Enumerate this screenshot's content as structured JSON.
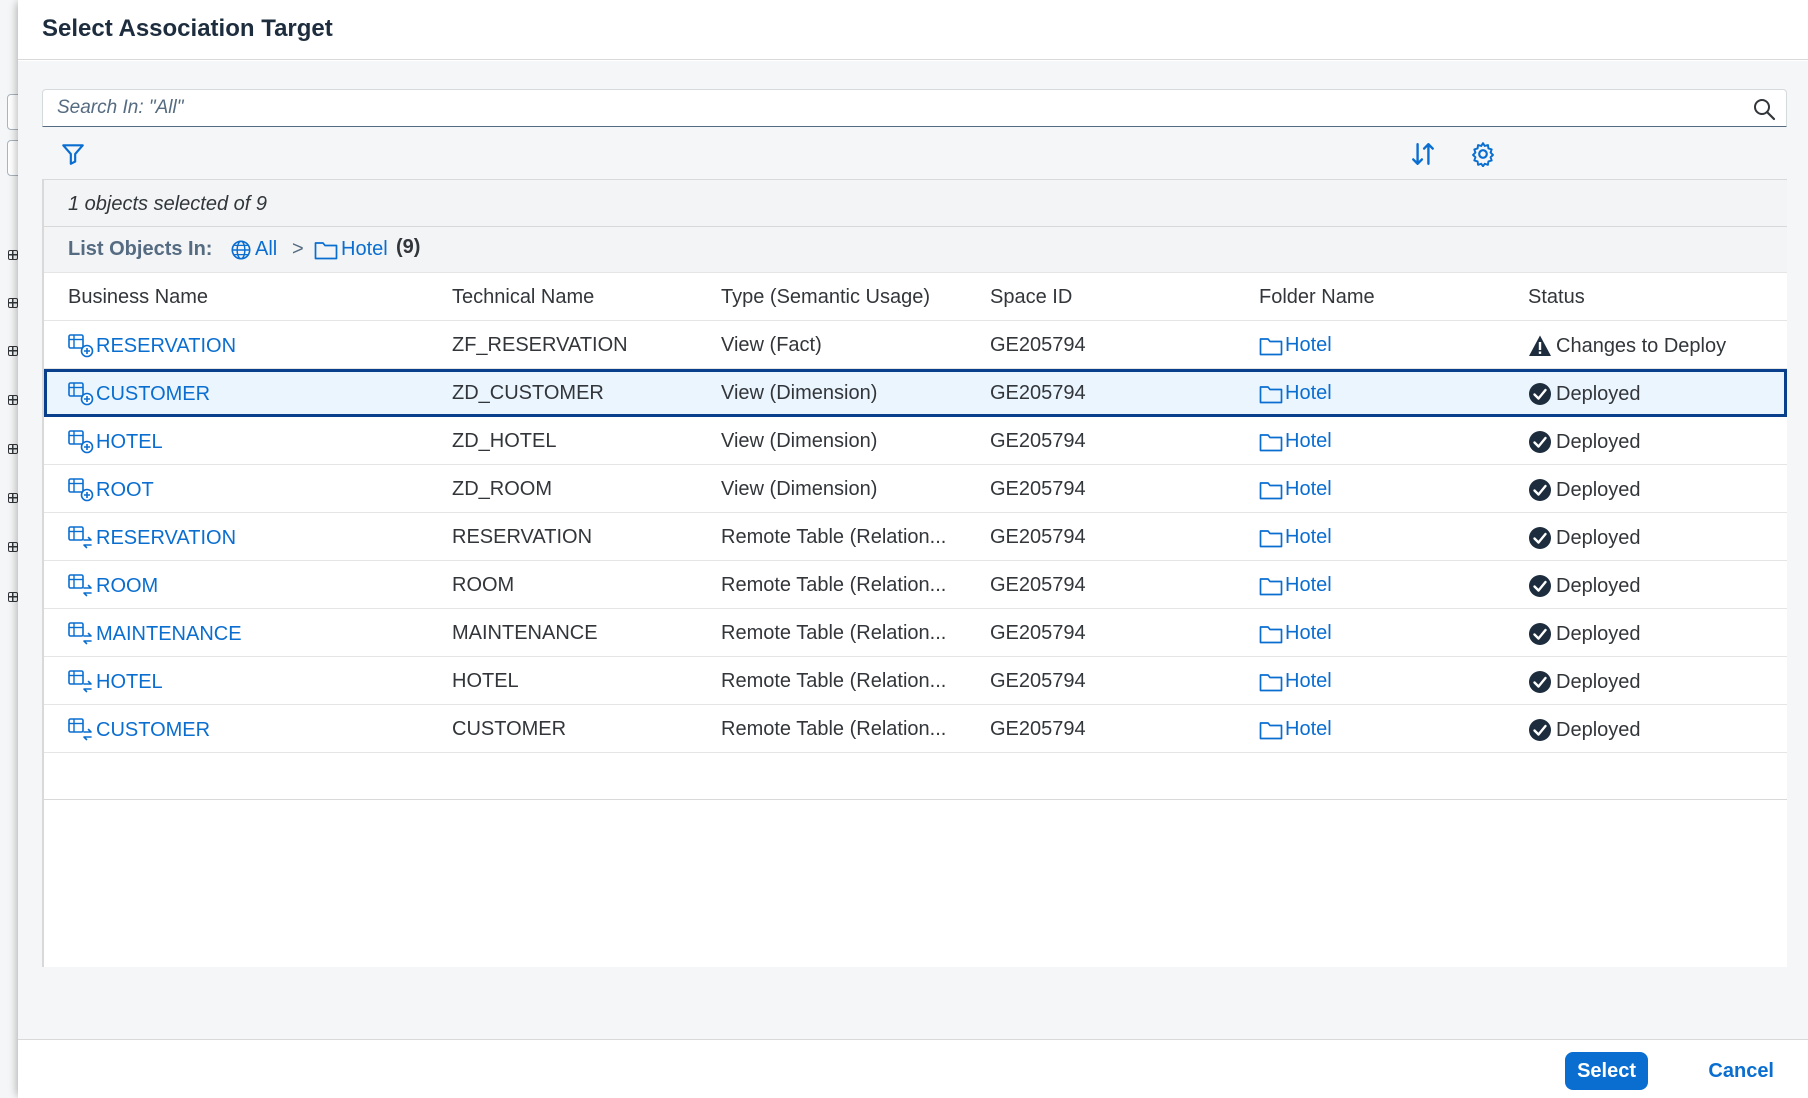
{
  "dialog": {
    "title": "Select Association Target"
  },
  "search": {
    "placeholder": "Search In: \"All\"",
    "icon": "search-icon"
  },
  "toolbar": {
    "filter_icon": "filter-icon",
    "sort_icon": "sort-icon",
    "settings_icon": "gear-icon"
  },
  "selection_info": "1 objects selected of 9",
  "breadcrumb": {
    "label": "List Objects In:",
    "root": "All",
    "separator": ">",
    "folder": "Hotel",
    "count": "(9)"
  },
  "table": {
    "columns": [
      "Business Name",
      "Technical Name",
      "Type (Semantic Usage)",
      "Space ID",
      "Folder Name",
      "Status"
    ],
    "rows": [
      {
        "business_name": "RESERVATION",
        "technical_name": "ZF_RESERVATION",
        "type": "View (Fact)",
        "space_id": "GE205794",
        "folder": "Hotel",
        "status": "Changes to Deploy",
        "icon": "view-icon",
        "status_icon": "warning-icon",
        "selected": false
      },
      {
        "business_name": "CUSTOMER",
        "technical_name": "ZD_CUSTOMER",
        "type": "View (Dimension)",
        "space_id": "GE205794",
        "folder": "Hotel",
        "status": "Deployed",
        "icon": "view-icon",
        "status_icon": "check-circle-icon",
        "selected": true
      },
      {
        "business_name": "HOTEL",
        "technical_name": "ZD_HOTEL",
        "type": "View (Dimension)",
        "space_id": "GE205794",
        "folder": "Hotel",
        "status": "Deployed",
        "icon": "view-icon",
        "status_icon": "check-circle-icon",
        "selected": false
      },
      {
        "business_name": "ROOT",
        "technical_name": "ZD_ROOM",
        "type": "View (Dimension)",
        "space_id": "GE205794",
        "folder": "Hotel",
        "status": "Deployed",
        "icon": "view-icon",
        "status_icon": "check-circle-icon",
        "selected": false
      },
      {
        "business_name": "RESERVATION",
        "technical_name": "RESERVATION",
        "type": "Remote Table (Relation...",
        "space_id": "GE205794",
        "folder": "Hotel",
        "status": "Deployed",
        "icon": "remote-table-icon",
        "status_icon": "check-circle-icon",
        "selected": false
      },
      {
        "business_name": "ROOM",
        "technical_name": "ROOM",
        "type": "Remote Table (Relation...",
        "space_id": "GE205794",
        "folder": "Hotel",
        "status": "Deployed",
        "icon": "remote-table-icon",
        "status_icon": "check-circle-icon",
        "selected": false
      },
      {
        "business_name": "MAINTENANCE",
        "technical_name": "MAINTENANCE",
        "type": "Remote Table (Relation...",
        "space_id": "GE205794",
        "folder": "Hotel",
        "status": "Deployed",
        "icon": "remote-table-icon",
        "status_icon": "check-circle-icon",
        "selected": false
      },
      {
        "business_name": "HOTEL",
        "technical_name": "HOTEL",
        "type": "Remote Table (Relation...",
        "space_id": "GE205794",
        "folder": "Hotel",
        "status": "Deployed",
        "icon": "remote-table-icon",
        "status_icon": "check-circle-icon",
        "selected": false
      },
      {
        "business_name": "CUSTOMER",
        "technical_name": "CUSTOMER",
        "type": "Remote Table (Relation...",
        "space_id": "GE205794",
        "folder": "Hotel",
        "status": "Deployed",
        "icon": "remote-table-icon",
        "status_icon": "check-circle-icon",
        "selected": false
      }
    ]
  },
  "footer": {
    "select_label": "Select",
    "cancel_label": "Cancel"
  },
  "colors": {
    "accent": "#0a6ed1",
    "selected_row_bg": "#ebf5fe",
    "selected_row_border": "#0a3f8c",
    "text": "#32363a"
  }
}
